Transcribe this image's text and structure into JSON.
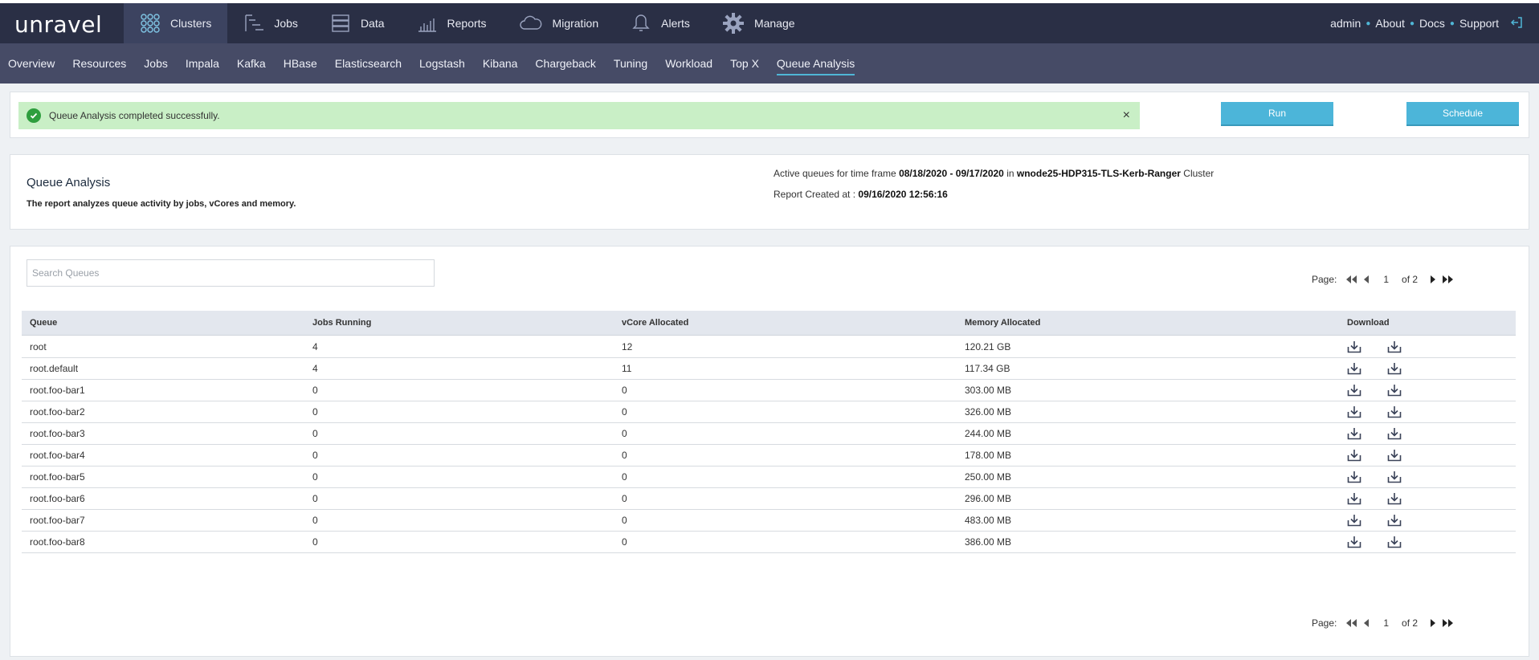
{
  "header": {
    "logo": "unravel",
    "nav": [
      {
        "label": "Clusters",
        "icon": "clusters-icon"
      },
      {
        "label": "Jobs",
        "icon": "jobs-icon"
      },
      {
        "label": "Data",
        "icon": "data-icon"
      },
      {
        "label": "Reports",
        "icon": "reports-icon"
      },
      {
        "label": "Migration",
        "icon": "cloud-icon"
      },
      {
        "label": "Alerts",
        "icon": "bell-icon"
      },
      {
        "label": "Manage",
        "icon": "gear-icon"
      }
    ],
    "right": {
      "user": "admin",
      "about": "About",
      "docs": "Docs",
      "support": "Support"
    }
  },
  "subnav": [
    "Overview",
    "Resources",
    "Jobs",
    "Impala",
    "Kafka",
    "HBase",
    "Elasticsearch",
    "Logstash",
    "Kibana",
    "Chargeback",
    "Tuning",
    "Workload",
    "Top X",
    "Queue Analysis"
  ],
  "alert": {
    "message": "Queue Analysis completed successfully.",
    "close": "×"
  },
  "actions": {
    "run": "Run",
    "schedule": "Schedule"
  },
  "report": {
    "title": "Queue Analysis",
    "subtitle": "The report analyzes queue activity by jobs, vCores and memory.",
    "timeframe_prefix": "Active queues for time frame",
    "timeframe": "08/18/2020 - 09/17/2020",
    "in": "in",
    "cluster": "wnode25-HDP315-TLS-Kerb-Ranger",
    "cluster_suffix": "Cluster",
    "created_label": "Report Created at :",
    "created_at": "09/16/2020 12:56:16"
  },
  "search": {
    "placeholder": "Search Queues"
  },
  "pager": {
    "label": "Page:",
    "page": "1",
    "of": "of 2"
  },
  "table": {
    "columns": [
      "Queue",
      "Jobs Running",
      "vCore Allocated",
      "Memory Allocated",
      "Download"
    ],
    "rows": [
      [
        "root",
        "4",
        "12",
        "120.21 GB"
      ],
      [
        "root.default",
        "4",
        "11",
        "117.34 GB"
      ],
      [
        "root.foo-bar1",
        "0",
        "0",
        "303.00 MB"
      ],
      [
        "root.foo-bar2",
        "0",
        "0",
        "326.00 MB"
      ],
      [
        "root.foo-bar3",
        "0",
        "0",
        "244.00 MB"
      ],
      [
        "root.foo-bar4",
        "0",
        "0",
        "178.00 MB"
      ],
      [
        "root.foo-bar5",
        "0",
        "0",
        "250.00 MB"
      ],
      [
        "root.foo-bar6",
        "0",
        "0",
        "296.00 MB"
      ],
      [
        "root.foo-bar7",
        "0",
        "0",
        "483.00 MB"
      ],
      [
        "root.foo-bar8",
        "0",
        "0",
        "386.00 MB"
      ]
    ]
  }
}
